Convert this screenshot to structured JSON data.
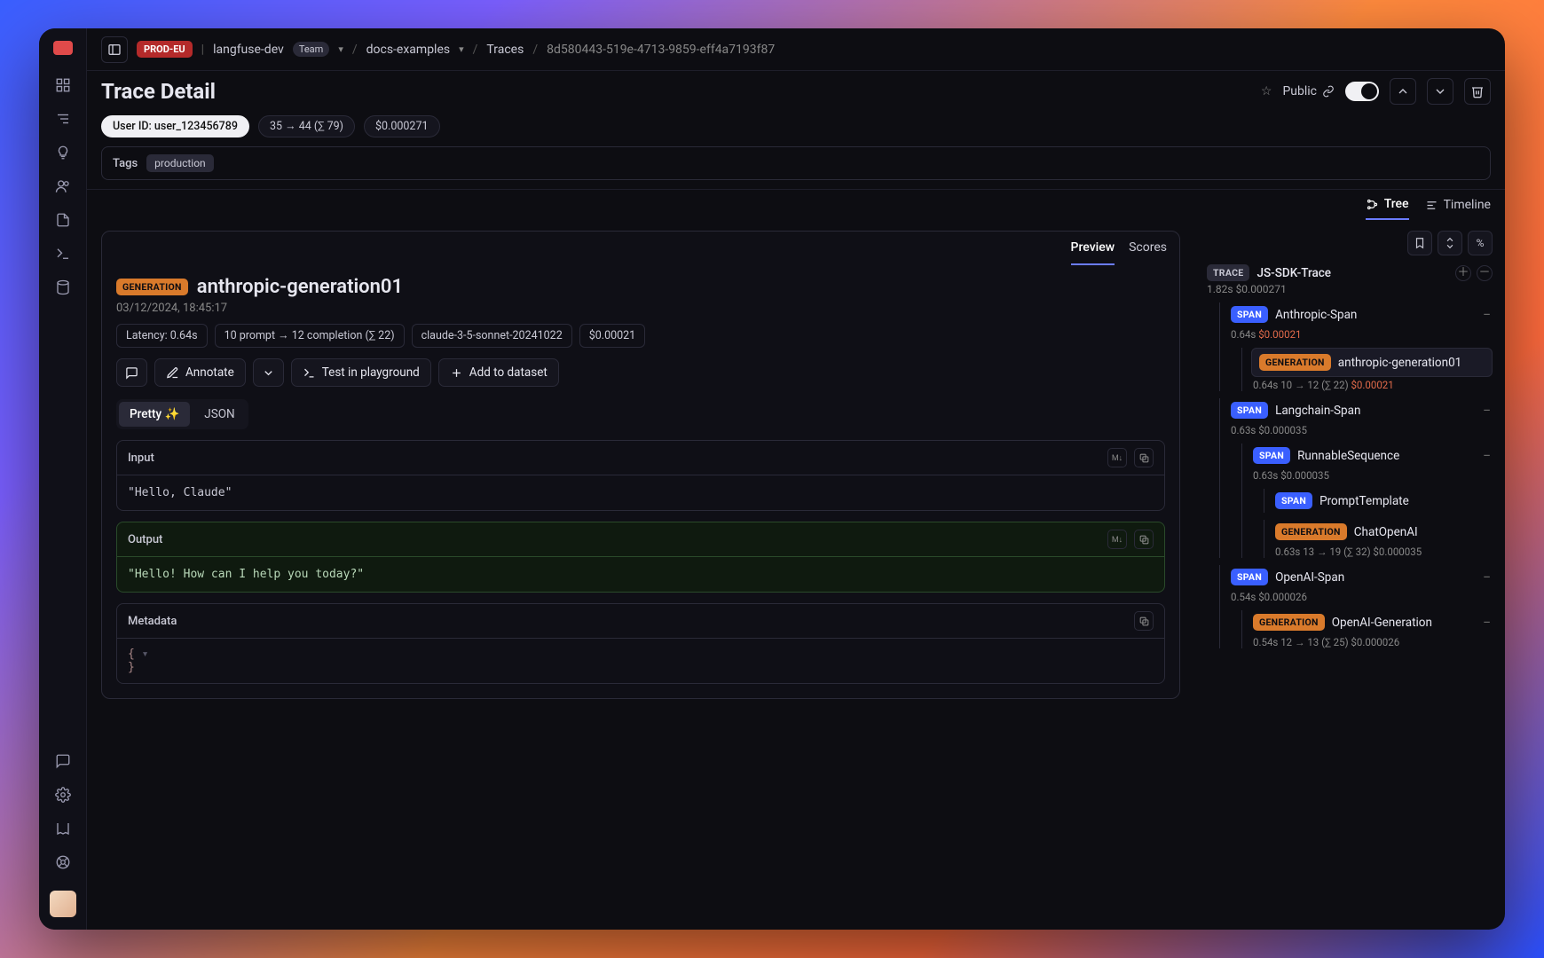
{
  "topbar": {
    "env_badge": "PROD-EU",
    "project": "langfuse-dev",
    "team_badge": "Team",
    "folder": "docs-examples",
    "section": "Traces",
    "trace_id": "8d580443-519e-4713-9859-eff4a7193f87"
  },
  "header": {
    "title": "Trace Detail",
    "public_label": "Public",
    "chips": {
      "user_id": "User ID: user_123456789",
      "tokens": "35 → 44 (∑ 79)",
      "cost": "$0.000271"
    },
    "tags_label": "Tags",
    "tags": [
      "production"
    ]
  },
  "view_tabs": {
    "tree": "Tree",
    "timeline": "Timeline"
  },
  "detail": {
    "tabs": {
      "preview": "Preview",
      "scores": "Scores"
    },
    "type_badge": "GENERATION",
    "name": "anthropic-generation01",
    "date": "03/12/2024, 18:45:17",
    "pills": {
      "latency": "Latency: 0.64s",
      "tokens": "10 prompt → 12 completion (∑ 22)",
      "model": "claude-3-5-sonnet-20241022",
      "cost": "$0.00021"
    },
    "actions": {
      "annotate": "Annotate",
      "playground": "Test in playground",
      "dataset": "Add to dataset"
    },
    "fmt": {
      "pretty": "Pretty ✨",
      "json": "JSON"
    },
    "input_label": "Input",
    "input_text": "\"Hello, Claude\"",
    "output_label": "Output",
    "output_text": "\"Hello! How can I help you today?\"",
    "metadata_label": "Metadata",
    "metadata_text": "{\n}"
  },
  "tree": {
    "trace_badge": "TRACE",
    "trace_name": "JS-SDK-Trace",
    "trace_sub": "1.82s  $0.000271",
    "nodes": [
      {
        "badge": "SPAN",
        "name": "Anthropic-Span",
        "sub": "0.64s",
        "sub_red": "$0.00021",
        "indent": 1
      },
      {
        "badge": "GENERATION",
        "name": "anthropic-generation01",
        "sub": "0.64s  10 → 12 (∑ 22)",
        "sub_red": "$0.00021",
        "indent": 2,
        "selected": true
      },
      {
        "badge": "SPAN",
        "name": "Langchain-Span",
        "sub": "0.63s  $0.000035",
        "indent": 1
      },
      {
        "badge": "SPAN",
        "name": "RunnableSequence",
        "sub": "0.63s  $0.000035",
        "indent": 2
      },
      {
        "badge": "SPAN",
        "name": "PromptTemplate",
        "indent": 3
      },
      {
        "badge": "GENERATION",
        "name": "ChatOpenAI",
        "sub": "0.63s  13 → 19 (∑ 32)  $0.000035",
        "indent": 3
      },
      {
        "badge": "SPAN",
        "name": "OpenAI-Span",
        "sub": "0.54s  $0.000026",
        "indent": 1
      },
      {
        "badge": "GENERATION",
        "name": "OpenAI-Generation",
        "sub": "0.54s  12 → 13 (∑ 25)  $0.000026",
        "indent": 2
      }
    ]
  }
}
